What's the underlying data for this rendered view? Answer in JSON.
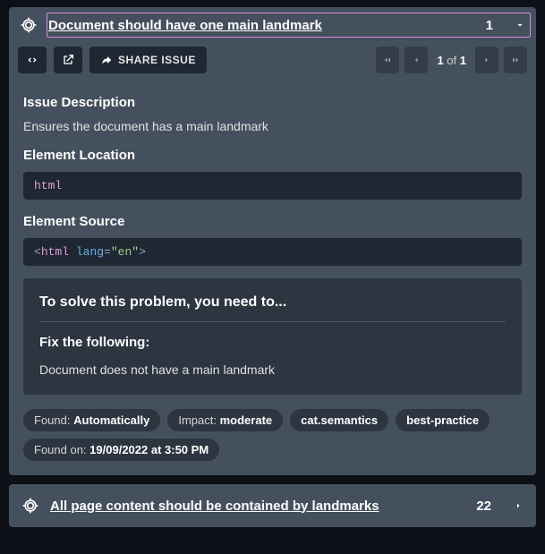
{
  "issue1": {
    "title": "Document should have one main landmark",
    "count": "1",
    "share": "SHARE ISSUE",
    "pager": {
      "current": "1",
      "of": "of",
      "total": "1"
    },
    "desc_h": "Issue Description",
    "desc_t": "Ensures the document has a main landmark",
    "loc_h": "Element Location",
    "loc_c": "html",
    "src_h": "Element Source",
    "src": {
      "tag": "html",
      "attr": "lang",
      "val": "\"en\""
    },
    "solve_h": "To solve this problem, you need to...",
    "fix_h": "Fix the following:",
    "fix_t": "Document does not have a main landmark",
    "tags": {
      "found_l": "Found:",
      "found_v": "Automatically",
      "impact_l": "Impact:",
      "impact_v": "moderate",
      "cat": "cat.semantics",
      "bp": "best-practice",
      "on_l": "Found on:",
      "on_v": "19/09/2022 at 3:50 PM"
    }
  },
  "issue2": {
    "title": "All page content should be contained by landmarks",
    "count": "22"
  }
}
